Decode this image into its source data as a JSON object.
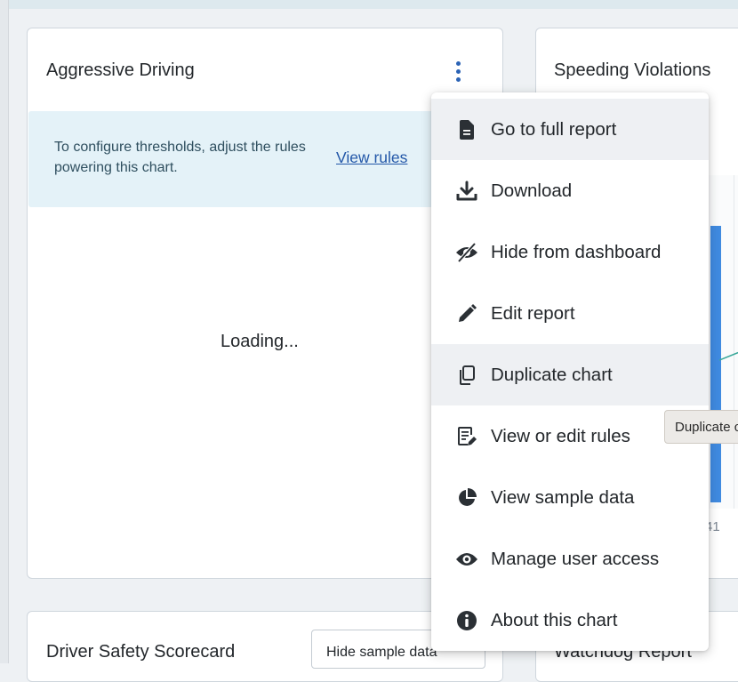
{
  "cards": {
    "aggressive": {
      "title": "Aggressive Driving",
      "banner_text": "To configure thresholds, adjust the rules powering this chart.",
      "banner_link": "View rules",
      "loading_text": "Loading..."
    },
    "speeding": {
      "title": "Speeding Violations",
      "axis_tick": "41"
    },
    "scorecard": {
      "title": "Driver Safety Scorecard",
      "sample_button": "Hide sample data"
    },
    "watchdog": {
      "title": "Watchdog Report"
    }
  },
  "menu": {
    "items": [
      {
        "label": "Go to full report",
        "icon": "document-icon"
      },
      {
        "label": "Download",
        "icon": "download-icon"
      },
      {
        "label": "Hide from dashboard",
        "icon": "eye-off-icon"
      },
      {
        "label": "Edit report",
        "icon": "pencil-icon"
      },
      {
        "label": "Duplicate chart",
        "icon": "copy-icon"
      },
      {
        "label": "View or edit rules",
        "icon": "rules-icon"
      },
      {
        "label": "View sample data",
        "icon": "pie-chart-icon"
      },
      {
        "label": "Manage user access",
        "icon": "eye-icon"
      },
      {
        "label": "About this chart",
        "icon": "info-icon"
      }
    ]
  },
  "tooltip": {
    "text": "Duplicate chart"
  },
  "colors": {
    "accent": "#2b63b5",
    "banner_bg": "#e4f2f8",
    "bar": "#3f8ae0"
  }
}
